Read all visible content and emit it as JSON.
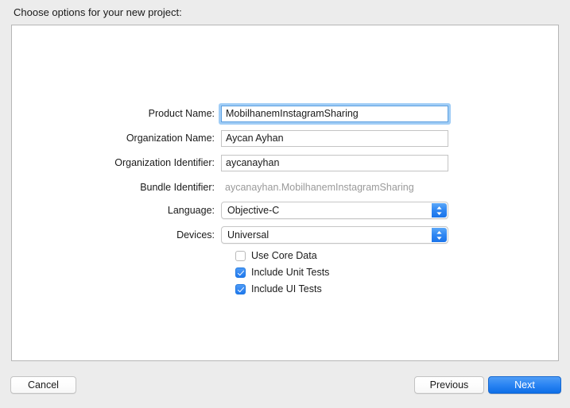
{
  "sheet": {
    "title": "Choose options for your new project:"
  },
  "form": {
    "fields": [
      {
        "label": "Product Name:",
        "value": "MobilhanemInstagramSharing",
        "type": "text",
        "focused": true
      },
      {
        "label": "Organization Name:",
        "value": "Aycan Ayhan",
        "type": "text",
        "focused": false
      },
      {
        "label": "Organization Identifier:",
        "value": "aycanayhan",
        "type": "text",
        "focused": false
      },
      {
        "label": "Bundle Identifier:",
        "value": "aycanayhan.MobilhanemInstagramSharing",
        "type": "readonly"
      },
      {
        "label": "Language:",
        "value": "Objective-C",
        "type": "popup"
      },
      {
        "label": "Devices:",
        "value": "Universal",
        "type": "popup"
      }
    ],
    "checkboxes": [
      {
        "label": "Use Core Data",
        "checked": false
      },
      {
        "label": "Include Unit Tests",
        "checked": true
      },
      {
        "label": "Include UI Tests",
        "checked": true
      }
    ]
  },
  "buttons": {
    "cancel": "Cancel",
    "previous": "Previous",
    "next": "Next"
  },
  "colors": {
    "accent": "#2c85f3",
    "window_background": "#ececec",
    "panel_background": "#ffffff",
    "readonly_text": "#9a9a9a",
    "focus_ring": "#8fc4f4"
  }
}
